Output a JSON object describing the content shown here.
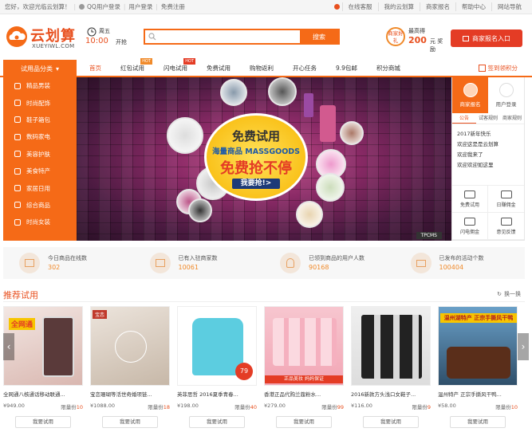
{
  "topbar": {
    "welcome": "您好，欢迎光临云划算！",
    "links": [
      "QQ用户登录",
      "用户登录",
      "免费注册"
    ],
    "right_links": [
      "在线客服",
      "我的云划算",
      "商家报名",
      "帮助中心",
      "网站导航"
    ]
  },
  "header": {
    "logo_cn": "云划算",
    "logo_en": "XUEYIWL.COM",
    "day": "周五",
    "time": "10:00",
    "open_label": "开抢",
    "search_placeholder": "",
    "search_button": "搜索",
    "reward_badge": "商家好礼",
    "reward_label": "最高得",
    "reward_amount": "200",
    "reward_unit": "元 奖励",
    "signup_button": "商家报名入口"
  },
  "nav": {
    "category_head": "试用品分类",
    "items": [
      {
        "label": "首页",
        "tag": ""
      },
      {
        "label": "红包试用",
        "tag": "HOT"
      },
      {
        "label": "闪电试用",
        "tag": "HOT"
      },
      {
        "label": "免费试用",
        "tag": ""
      },
      {
        "label": "购物返利",
        "tag": ""
      },
      {
        "label": "开心任务",
        "tag": ""
      },
      {
        "label": "9.9包邮",
        "tag": ""
      },
      {
        "label": "积分商城",
        "tag": ""
      }
    ],
    "sign_in": "签到领积分"
  },
  "categories": [
    "精品男装",
    "时尚配饰",
    "鞋子箱包",
    "数码家电",
    "美容护肤",
    "美食特产",
    "家居日用",
    "综合商品",
    "时尚女装"
  ],
  "banner": {
    "line1": "免费试用",
    "line2": "海量商品 MASSGOODS",
    "line3": "免费抢不停",
    "cta": "我要抢!>",
    "watermark": "TPCMS"
  },
  "side": {
    "tab_merchant": "商家报名",
    "tab_user": "用户登录",
    "notice_tabs": [
      "公告",
      "试客规则",
      "商家规则"
    ],
    "notices": [
      "2017新年快乐",
      "欢迎这是是云划算",
      "欢迎我来了",
      "欢迎欢迎如这里"
    ],
    "services": [
      "免费试用",
      "日赚佣金",
      "闪电佣金",
      "意见反馈"
    ]
  },
  "stats": [
    {
      "label": "今日商品在线数",
      "value": "302"
    },
    {
      "label": "已有入驻商家数",
      "value": "10061"
    },
    {
      "label": "已领到商品的用户人数",
      "value": "90168"
    },
    {
      "label": "已发布的活动个数",
      "value": "100404"
    }
  ],
  "recommend": {
    "title": "推荐试用",
    "refresh": "换一换",
    "products": [
      {
        "name": "全网通八核通话移动联通...",
        "price": "¥949.00",
        "limit_label": "限量份",
        "limit": "10",
        "button": "我要试用"
      },
      {
        "name": "宝恋珊瑚等活世奇婚项链...",
        "price": "¥1088.00",
        "limit_label": "限量份",
        "limit": "18",
        "button": "我要试用"
      },
      {
        "name": "英菲思哲  2016夏季青春...",
        "price": "¥198.00",
        "limit_label": "限量份",
        "limit": "40",
        "button": "我要试用"
      },
      {
        "name": "香港正品代购兰蔻粉水...",
        "price": "¥279.00",
        "limit_label": "限量份",
        "limit": "99",
        "button": "我要试用"
      },
      {
        "name": "2016新款方头浅口女鞋子...",
        "price": "¥116.00",
        "limit_label": "限量份",
        "limit": "9",
        "button": "我要试用"
      },
      {
        "name": "温州特产 正宗手撕风干鸭...",
        "price": "¥58.00",
        "limit_label": "限量份",
        "limit": "10",
        "button": "我要试用"
      }
    ],
    "badges": {
      "p1": "全网通",
      "p2": "宝恋",
      "p3_price": "79",
      "p4": "正品美妆  妈妈保证",
      "p6": "温州湖特产 正宗手撕风干鸭"
    }
  }
}
